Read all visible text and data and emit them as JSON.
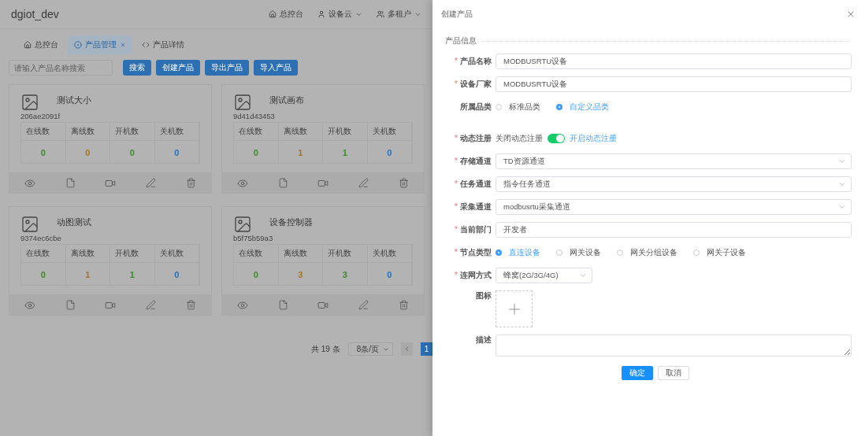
{
  "header": {
    "title": "dgiot_dev",
    "nav": [
      {
        "label": "总控台",
        "kind": "home",
        "dropdown": false
      },
      {
        "label": "设备云",
        "kind": "device",
        "dropdown": true
      },
      {
        "label": "多租户",
        "kind": "users",
        "dropdown": true
      }
    ]
  },
  "tabs": [
    {
      "label": "总控台",
      "kind": "home",
      "selected": false,
      "closable": false
    },
    {
      "label": "产品管理",
      "kind": "product",
      "selected": true,
      "closable": true
    },
    {
      "label": "产品详情",
      "kind": "code",
      "selected": false,
      "closable": false
    }
  ],
  "toolbar": {
    "placeholder": "请输入产品名称搜索",
    "buttons": [
      "搜索",
      "创建产品",
      "导出产品",
      "导入产品"
    ]
  },
  "products": [
    {
      "name": "测试大小",
      "id": "206ae2091f",
      "stats": [
        {
          "label": "在线数",
          "value": "0",
          "color": "#3f8a2a"
        },
        {
          "label": "离线数",
          "value": "0",
          "color": "#a8741f"
        },
        {
          "label": "开机数",
          "value": "0",
          "color": "#3f8a2a"
        },
        {
          "label": "关机数",
          "value": "0",
          "color": "#2a70b8"
        }
      ]
    },
    {
      "name": "测试画布",
      "id": "9d41d43453",
      "stats": [
        {
          "label": "在线数",
          "value": "0",
          "color": "#3f8a2a"
        },
        {
          "label": "离线数",
          "value": "1",
          "color": "#a8741f"
        },
        {
          "label": "开机数",
          "value": "1",
          "color": "#3f8a2a"
        },
        {
          "label": "关机数",
          "value": "0",
          "color": "#2a70b8"
        }
      ]
    },
    {
      "name": "动图测试",
      "id": "9374ec6cbe",
      "stats": [
        {
          "label": "在线数",
          "value": "0",
          "color": "#3f8a2a"
        },
        {
          "label": "离线数",
          "value": "1",
          "color": "#a8741f"
        },
        {
          "label": "开机数",
          "value": "1",
          "color": "#3f8a2a"
        },
        {
          "label": "关机数",
          "value": "0",
          "color": "#2a70b8"
        }
      ]
    },
    {
      "name": "设备控制器",
      "id": "b5f75b59a3",
      "stats": [
        {
          "label": "在线数",
          "value": "0",
          "color": "#3f8a2a"
        },
        {
          "label": "离线数",
          "value": "3",
          "color": "#a8741f"
        },
        {
          "label": "开机数",
          "value": "3",
          "color": "#3f8a2a"
        },
        {
          "label": "关机数",
          "value": "0",
          "color": "#2a70b8"
        }
      ]
    }
  ],
  "pagination": {
    "total": "共 19 条",
    "page_size": "8条/页",
    "pages": [
      {
        "label": "1",
        "selected": true
      }
    ]
  },
  "drawer": {
    "title": "创建产品",
    "section": "产品信息",
    "required_mark": "*",
    "fields": [
      {
        "kind": "text",
        "label": "产品名称",
        "required": true,
        "value": "MODBUSRTU设备"
      },
      {
        "kind": "text",
        "label": "设备厂家",
        "required": true,
        "value": "MODBUSRTU设备"
      },
      {
        "kind": "radio",
        "label": "所属品类",
        "required": false,
        "options": [
          {
            "label": "标准品类",
            "selected": false
          },
          {
            "label": "自定义品类",
            "selected": true
          }
        ]
      },
      {
        "kind": "switch",
        "label": "动态注册",
        "required": true,
        "off_label": "关闭动态注册",
        "on_label": "开启动态注册",
        "on": true
      },
      {
        "kind": "select",
        "label": "存储通道",
        "required": true,
        "value": "TD资源通道"
      },
      {
        "kind": "select",
        "label": "任务通道",
        "required": true,
        "value": "指令任务通道"
      },
      {
        "kind": "select",
        "label": "采集通道",
        "required": true,
        "value": "modbusrtu采集通道"
      },
      {
        "kind": "text",
        "label": "当前部门",
        "required": true,
        "value": "开发者"
      },
      {
        "kind": "radio",
        "label": "节点类型",
        "required": true,
        "options": [
          {
            "label": "直连设备",
            "selected": true
          },
          {
            "label": "网关设备",
            "selected": false
          },
          {
            "label": "网关分组设备",
            "selected": false
          },
          {
            "label": "网关子设备",
            "selected": false
          }
        ]
      },
      {
        "kind": "short-select",
        "label": "连网方式",
        "required": true,
        "value": "蜂窝(2G/3G/4G)"
      },
      {
        "kind": "upload",
        "label": "图标",
        "required": false
      },
      {
        "kind": "textarea",
        "label": "描述",
        "required": false
      }
    ],
    "buttons": [
      {
        "label": "确定",
        "primary": true
      },
      {
        "label": "取消",
        "primary": false
      }
    ]
  }
}
